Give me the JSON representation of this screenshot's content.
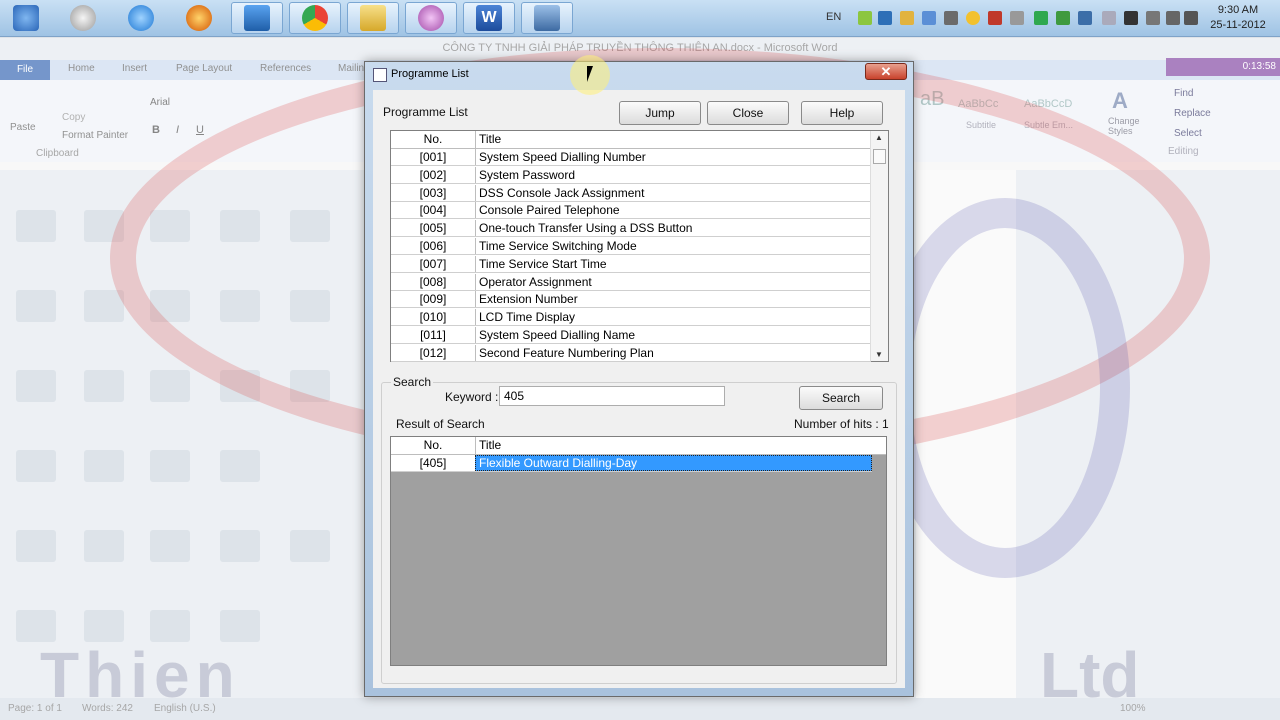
{
  "taskbar": {
    "apps": [
      {
        "name": "windows-start",
        "color": "#3a7bd5"
      },
      {
        "name": "chrome-legacy",
        "color": "#d24a3c"
      },
      {
        "name": "internet-explorer",
        "color": "#2f8fe0"
      },
      {
        "name": "firefox",
        "color": "#e67e22"
      },
      {
        "name": "blue-app",
        "color": "#2e7bc4"
      },
      {
        "name": "chrome",
        "color": "#34a853"
      },
      {
        "name": "folder",
        "color": "#e8c24a"
      },
      {
        "name": "paint",
        "color": "#c36cc7"
      },
      {
        "name": "word",
        "color": "#2a5aa8"
      },
      {
        "name": "remote-desktop",
        "color": "#4a6e9c"
      }
    ],
    "language": "EN",
    "time": "9:30 AM",
    "date": "25-11-2012"
  },
  "word": {
    "title": "CÔNG TY TNHH GIẢI PHÁP TRUYỀN THÔNG THIÊN AN.docx - Microsoft Word",
    "tabs": [
      "File",
      "Home",
      "Insert",
      "Page Layout",
      "References",
      "Mailings"
    ],
    "font_name": "Arial",
    "clipboard_label": "Clipboard",
    "paste_label": "Paste",
    "format_painter": "Format Painter",
    "copy_label": "Copy",
    "styles": [
      "AaBbCc",
      "AaBbCcD"
    ],
    "style_names": [
      "Subtitle",
      "Subtle Em..."
    ],
    "change_styles": "Change Styles",
    "find": "Find",
    "replace": "Replace",
    "select": "Select",
    "editing": "Editing",
    "status_page": "Page: 1 of 1",
    "status_words": "Words: 242",
    "status_lang": "English (U.S.)",
    "zoom": "100%",
    "recorder_time": "0:13:58"
  },
  "dialog": {
    "title": "Programme List",
    "section_label": "Programme List",
    "buttons": {
      "jump": "Jump",
      "close": "Close",
      "help": "Help",
      "search": "Search"
    },
    "table_headers": {
      "no": "No.",
      "title": "Title"
    },
    "rows": [
      {
        "no": "[001]",
        "title": "System Speed Dialling Number"
      },
      {
        "no": "[002]",
        "title": "System Password"
      },
      {
        "no": "[003]",
        "title": "DSS Console Jack Assignment"
      },
      {
        "no": "[004]",
        "title": "Console Paired Telephone"
      },
      {
        "no": "[005]",
        "title": "One-touch Transfer Using a DSS Button"
      },
      {
        "no": "[006]",
        "title": "Time Service Switching Mode"
      },
      {
        "no": "[007]",
        "title": "Time Service Start Time"
      },
      {
        "no": "[008]",
        "title": "Operator Assignment"
      },
      {
        "no": "[009]",
        "title": "Extension Number"
      },
      {
        "no": "[010]",
        "title": "LCD Time Display"
      },
      {
        "no": "[011]",
        "title": "System Speed Dialling Name"
      },
      {
        "no": "[012]",
        "title": "Second Feature Numbering Plan"
      }
    ],
    "search": {
      "group_label": "Search",
      "keyword_label": "Keyword :",
      "keyword_value": "405",
      "result_label": "Result of Search",
      "hits_label": "Number of hits : 1",
      "results": [
        {
          "no": "[405]",
          "title": "Flexible Outward Dialling-Day"
        }
      ]
    }
  }
}
